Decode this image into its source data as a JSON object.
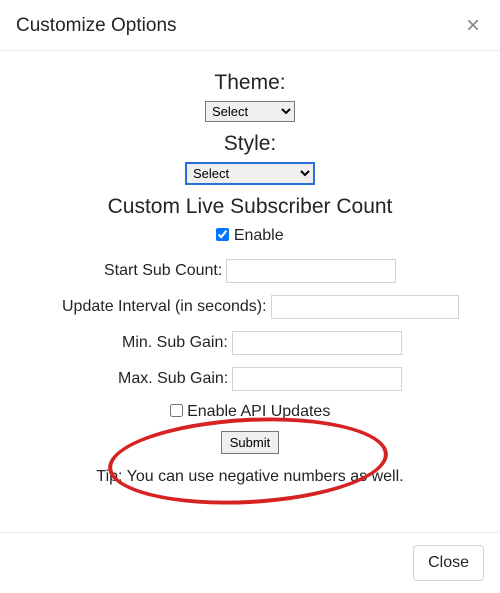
{
  "header": {
    "title": "Customize Options",
    "close_glyph": "×"
  },
  "theme": {
    "label": "Theme:",
    "selected": "Select"
  },
  "style": {
    "label": "Style:",
    "selected": "Select"
  },
  "custom_count": {
    "header": "Custom Live Subscriber Count",
    "enable_checked": true,
    "enable_label": " Enable",
    "fields": {
      "start_sub": {
        "label": "Start Sub Count:",
        "value": ""
      },
      "update_interval": {
        "label": "Update Interval (in seconds):",
        "value": ""
      },
      "min_gain": {
        "label": "Min. Sub Gain:",
        "value": ""
      },
      "max_gain": {
        "label": "Max. Sub Gain:",
        "value": ""
      }
    },
    "api": {
      "checked": false,
      "label": " Enable API Updates"
    },
    "submit_label": "Submit",
    "tip": "Tip: You can use negative numbers as well."
  },
  "footer": {
    "close_label": "Close"
  }
}
